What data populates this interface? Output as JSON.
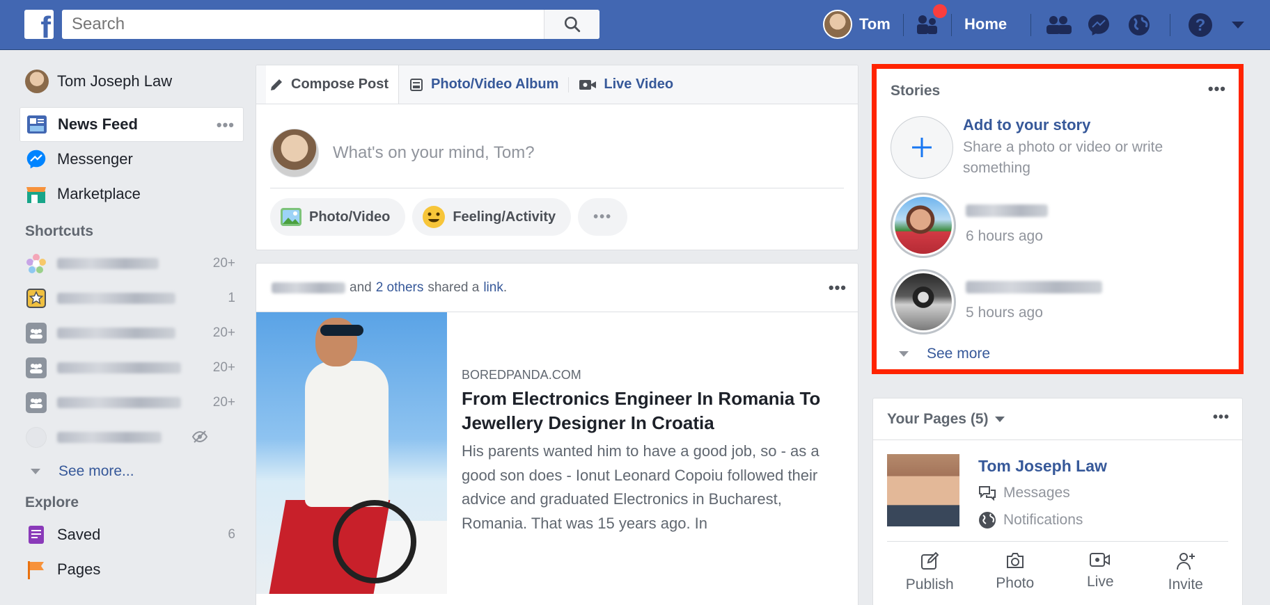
{
  "topbar": {
    "logo": "f",
    "search_placeholder": "Search",
    "user_name": "Tom",
    "home": "Home",
    "brand_color": "#4267b2"
  },
  "leftnav": {
    "user": "Tom Joseph Law",
    "items": [
      {
        "label": "News Feed",
        "icon": "news-feed-icon"
      },
      {
        "label": "Messenger",
        "icon": "messenger-icon"
      },
      {
        "label": "Marketplace",
        "icon": "marketplace-icon"
      }
    ],
    "shortcuts_heading": "Shortcuts",
    "shortcuts": [
      {
        "count": "20+"
      },
      {
        "count": "1"
      },
      {
        "count": "20+"
      },
      {
        "count": "20+"
      },
      {
        "count": "20+"
      },
      {
        "count": ""
      }
    ],
    "see_more": "See more...",
    "explore_heading": "Explore",
    "explore": [
      {
        "label": "Saved",
        "count": "6"
      },
      {
        "label": "Pages",
        "count": ""
      }
    ]
  },
  "composer": {
    "tabs": [
      "Compose Post",
      "Photo/Video Album",
      "Live Video"
    ],
    "placeholder": "What's on your mind, Tom?",
    "actions": [
      "Photo/Video",
      "Feeling/Activity"
    ],
    "more": "•••"
  },
  "post": {
    "header_and": "and",
    "header_others": "2 others",
    "header_shared": "shared a",
    "header_link": "link",
    "domain": "BOREDPANDA.COM",
    "title": "From Electronics Engineer In Romania To Jewellery Designer In Croatia",
    "description": "His parents wanted him to have a good job, so - as a good son does - Ionut Leonard Copoiu followed their advice and graduated Electronics in Bucharest, Romania. That was 15 years ago. In"
  },
  "stories": {
    "heading": "Stories",
    "add_title": "Add to your story",
    "add_sub": "Share a photo or video or write something",
    "items": [
      {
        "time": "6 hours ago"
      },
      {
        "time": "5 hours ago"
      }
    ],
    "see_more": "See more",
    "highlight_color": "#ff2300"
  },
  "pages": {
    "heading": "Your Pages (5)",
    "name": "Tom Joseph Law",
    "messages": "Messages",
    "notifications": "Notifications",
    "actions": [
      "Publish",
      "Photo",
      "Live",
      "Invite"
    ]
  }
}
